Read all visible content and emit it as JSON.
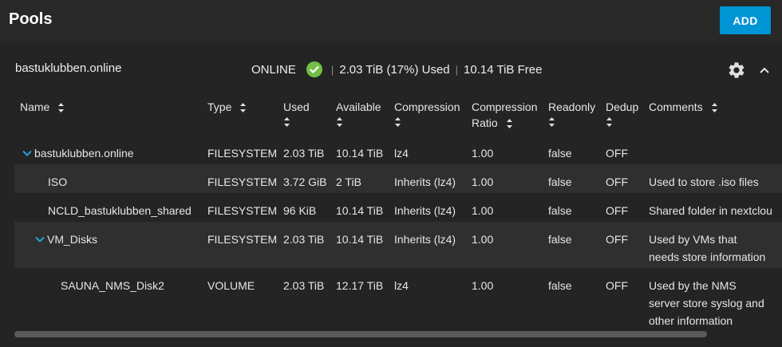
{
  "header": {
    "title": "Pools",
    "add_label": "ADD"
  },
  "pool": {
    "name": "bastuklubben.online",
    "status": "ONLINE",
    "used": "2.03 TiB (17%) Used",
    "free": "10.14 TiB Free",
    "colors": {
      "status_ok": "#71bf44",
      "accent": "#0095d5"
    }
  },
  "table": {
    "headers": {
      "name": "Name",
      "type": "Type",
      "used": "Used",
      "available": "Available",
      "compression": "Compression",
      "ratio_1": "Compression",
      "ratio_2": "Ratio",
      "readonly": "Readonly",
      "dedup": "Dedup",
      "comments": "Comments"
    },
    "rows": [
      {
        "name": "bastuklubben.online",
        "type": "FILESYSTEM",
        "used": "2.03 TiB",
        "available": "10.14 TiB",
        "compression": "lz4",
        "ratio": "1.00",
        "readonly": "false",
        "dedup": "OFF",
        "comments": ""
      },
      {
        "name": "ISO",
        "type": "FILESYSTEM",
        "used": "3.72 GiB",
        "available": "2 TiB",
        "compression": "Inherits (lz4)",
        "ratio": "1.00",
        "readonly": "false",
        "dedup": "OFF",
        "comments": "Used to store .iso files"
      },
      {
        "name": "NCLD_bastuklubben_shared",
        "type": "FILESYSTEM",
        "used": "96 KiB",
        "available": "10.14 TiB",
        "compression": "Inherits (lz4)",
        "ratio": "1.00",
        "readonly": "false",
        "dedup": "OFF",
        "comments": "Shared folder in nextclou"
      },
      {
        "name": "VM_Disks",
        "type": "FILESYSTEM",
        "used": "2.03 TiB",
        "available": "10.14 TiB",
        "compression": "Inherits (lz4)",
        "ratio": "1.00",
        "readonly": "false",
        "dedup": "OFF",
        "comments": "Used by VMs that needs store information"
      },
      {
        "name": "SAUNA_NMS_Disk2",
        "type": "VOLUME",
        "used": "2.03 TiB",
        "available": "12.17 TiB",
        "compression": "lz4",
        "ratio": "1.00",
        "readonly": "false",
        "dedup": "OFF",
        "comments": "Used by the NMS server store syslog and other information"
      }
    ]
  },
  "icons": [
    "check-circle-icon",
    "gear-icon",
    "chevron-up-icon",
    "sort-icon",
    "chevron-down-icon"
  ]
}
